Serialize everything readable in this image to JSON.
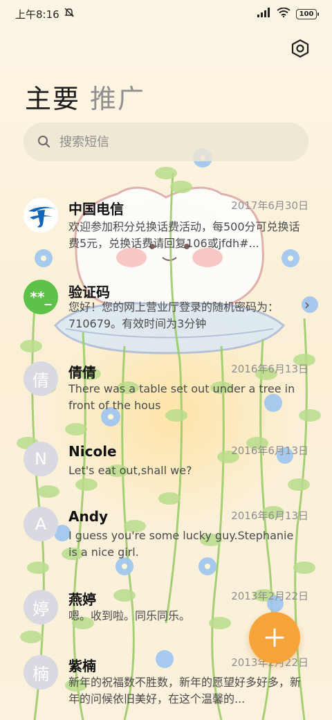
{
  "status_bar": {
    "time": "上午8:16",
    "battery": "100"
  },
  "tabs": [
    {
      "label": "主要"
    },
    {
      "label": "推广"
    }
  ],
  "search": {
    "placeholder": "搜索短信"
  },
  "conversations": [
    {
      "name": "中国电信",
      "date": "2017年6月30日",
      "preview": "欢迎参加积分兑换话费活动，每500分可兑换话费5元，兑换话费请回复106或jfdh#...",
      "avatar": "ct-logo"
    },
    {
      "name": "验证码",
      "date": "",
      "preview": "您好！您的网上营业厅登录的随机密码为：710679。有效时间为3分钟",
      "avatar": "**_"
    },
    {
      "name": "倩倩",
      "date": "2016年6月13日",
      "preview": "There was a table set out under a tree in front of the hous",
      "avatar": "倩"
    },
    {
      "name": "Nicole",
      "date": "2016年6月13日",
      "preview": "Let's eat out,shall we?",
      "avatar": "N"
    },
    {
      "name": "Andy",
      "date": "2016年6月13日",
      "preview": "I guess you're some lucky guy.Stephanie is a nice girl.",
      "avatar": "A"
    },
    {
      "name": "燕婷",
      "date": "2013年2月22日",
      "preview": "嗯。收到啦。同乐同乐。",
      "avatar": "婷"
    },
    {
      "name": "紫楠",
      "date": "2013年2月22日",
      "preview": "新年的祝福数不胜数，新年的愿望好多好多，新年的问候依旧美好，在这个温馨的...",
      "avatar": "楠"
    }
  ],
  "colors": {
    "accent": "#f6a43a",
    "code_avatar": "#5ec24a",
    "letter_avatar": "#d9d9e2",
    "ct_blue": "#1266b8"
  }
}
